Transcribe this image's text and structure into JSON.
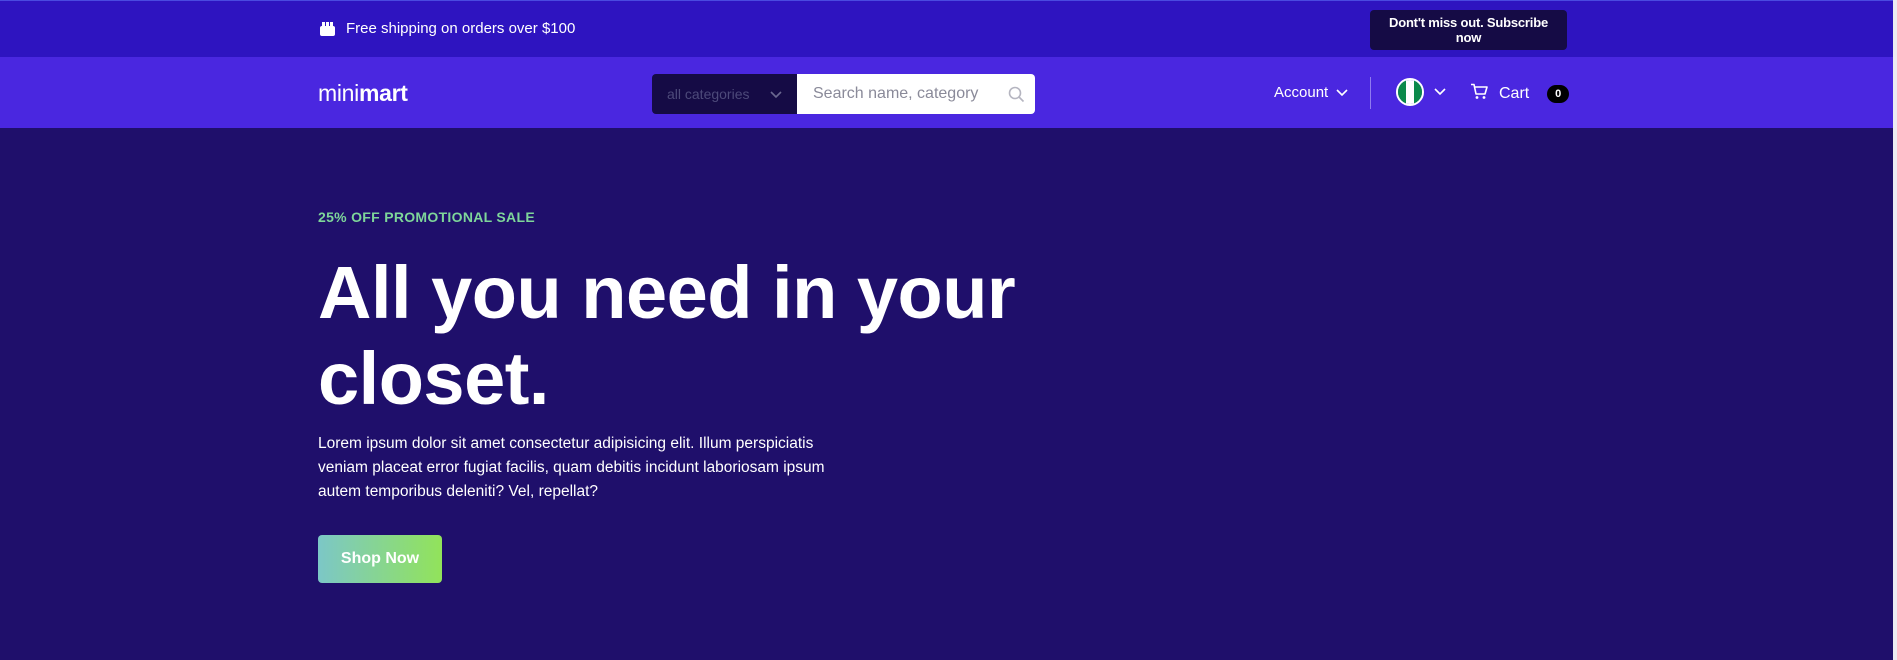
{
  "topbar": {
    "shipping_text": "Free shipping on orders over $100",
    "subscribe_label": "Dont't miss out. Subscribe now"
  },
  "navbar": {
    "logo_light": "mini",
    "logo_bold": "mart",
    "category_select": "all categories",
    "search_placeholder": "Search name, category",
    "account_label": "Account",
    "cart_label": "Cart",
    "cart_count": "0"
  },
  "hero": {
    "promo": "25% OFF PROMOTIONAL SALE",
    "headline": "All you need in your closet.",
    "description": "Lorem ipsum dolor sit amet consectetur adipisicing elit. Illum perspiciatis veniam placeat error fugiat facilis, quam debitis incidunt laboriosam ipsum autem temporibus deleniti? Vel, repellat?",
    "cta_label": "Shop Now"
  },
  "icons": {
    "gift": "gift-icon",
    "search": "search-icon",
    "chevron": "chevron-down-icon",
    "cart": "cart-icon",
    "flag": "nigeria-flag-icon"
  },
  "colors": {
    "topbar": "#2e14c0",
    "navbar": "#4a27e0",
    "hero_bg": "#1f0f6b",
    "promo": "#7ed69a",
    "cta_gradient_start": "#7cc7c7",
    "cta_gradient_end": "#92e35a"
  }
}
